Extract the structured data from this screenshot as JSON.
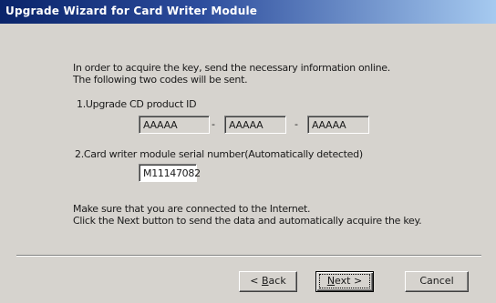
{
  "window": {
    "title": "Upgrade Wizard for Card Writer Module"
  },
  "intro": {
    "line1": "In order to acquire the key, send the necessary information online.",
    "line2": "The following two codes will be sent."
  },
  "product_id": {
    "label": "1.Upgrade CD product ID",
    "fields": [
      "AAAAA",
      "AAAAA",
      "AAAAA"
    ],
    "separator": "-"
  },
  "serial": {
    "label": "2.Card writer module serial number(Automatically detected)",
    "value": "M11147082"
  },
  "footer_text": {
    "line1": "Make sure that you are connected to the Internet.",
    "line2": "Click the Next button to send the data and automatically acquire the key."
  },
  "buttons": {
    "back": {
      "prefix": "< ",
      "mnemonic": "B",
      "rest": "ack"
    },
    "next": {
      "mnemonic": "N",
      "rest": "ext >"
    },
    "cancel": "Cancel"
  }
}
